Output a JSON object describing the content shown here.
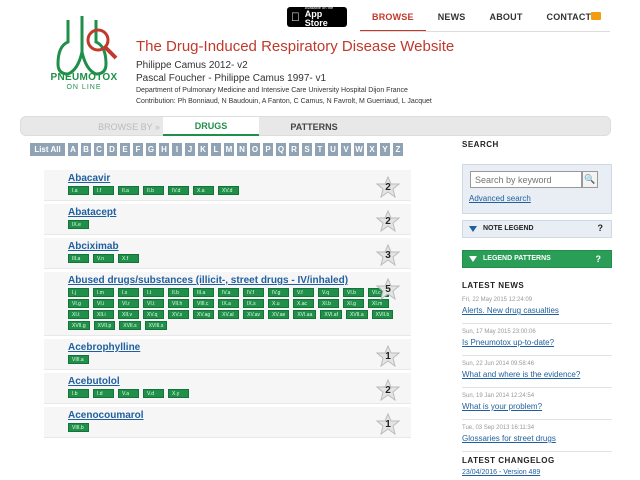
{
  "app_store": {
    "small": "Available on the",
    "big": "App Store"
  },
  "nav": [
    "BROWSE",
    "NEWS",
    "ABOUT",
    "CONTACT"
  ],
  "logo": {
    "word": "PNEUMOTOX",
    "sub": "ON LINE"
  },
  "header": {
    "title": "The Drug-Induced Respiratory Disease Website",
    "line1": "Philippe Camus 2012- v2",
    "line2": "Pascal Foucher - Philippe Camus 1997- v1",
    "line3": "Department of Pulmonary Medicine and Intensive Care University Hospital Dijon France",
    "line4": "Contribution: Ph Bonniaud, N Baudouin, A Fanton, C Camus, N Favrolt, M Guerriaud, L Jacquet"
  },
  "tabs": {
    "browse_by": "BROWSE BY »",
    "drugs": "DRUGS",
    "patterns": "PATTERNS"
  },
  "alphabet": {
    "all": "List All",
    "letters": [
      "A",
      "B",
      "C",
      "D",
      "E",
      "F",
      "G",
      "H",
      "I",
      "J",
      "K",
      "L",
      "M",
      "N",
      "O",
      "P",
      "Q",
      "R",
      "S",
      "T",
      "U",
      "V",
      "W",
      "X",
      "Y",
      "Z"
    ]
  },
  "drugs": [
    {
      "name": "Abacavir",
      "count": "2",
      "codes": [
        "I.a",
        "I.f",
        "II.a",
        "II.b",
        "IV.d",
        "X.a",
        "XV.d"
      ]
    },
    {
      "name": "Abatacept",
      "count": "2",
      "codes": [
        "IX.e"
      ]
    },
    {
      "name": "Abciximab",
      "count": "3",
      "codes": [
        "III.a",
        "V.n",
        "X.f"
      ]
    },
    {
      "name": "Abused drugs/substances (illicit-, street drugs - IV/inhaled)",
      "count": "5",
      "codes": [
        "I.j",
        "I.m",
        "I.s",
        "I.t",
        "II.b",
        "III.a",
        "IV.a",
        "IV.f",
        "IV.g",
        "V.f",
        "V.q",
        "VI.b",
        "VI.c",
        "VI.g",
        "VI.i",
        "VI.r",
        "VI.t",
        "VII.h",
        "VIII.c",
        "IX.a",
        "IX.s",
        "X.u",
        "X.ac",
        "XI.b",
        "XI.g",
        "XI.m",
        "XI.t",
        "XII.i",
        "XII.v",
        "XV.q",
        "XV.s",
        "XV.ag",
        "XV.al",
        "XV.av",
        "XV.ae",
        "XVI.aa",
        "XVI.af",
        "XVII.a",
        "XVII.b",
        "XVII.g",
        "XVII.p",
        "XVII.s",
        "XVIII.s"
      ]
    },
    {
      "name": "Acebrophylline",
      "count": "1",
      "codes": [
        "VIII.a"
      ]
    },
    {
      "name": "Acebutolol",
      "count": "2",
      "codes": [
        "I.b",
        "I.d",
        "V.a",
        "V.d",
        "X.y"
      ]
    },
    {
      "name": "Acenocoumarol",
      "count": "1",
      "codes": [
        "VIII.b"
      ]
    }
  ],
  "sidebar": {
    "search_head": "SEARCH",
    "search_placeholder": "Search by keyword",
    "advanced": "Advanced search",
    "note_legend": "NOTE LEGEND",
    "legend_patterns": "LEGEND PATTERNS",
    "q": "?",
    "latest_news_head": "LATEST NEWS",
    "news": [
      {
        "date": "Fri, 22 May 2015 12:24:09",
        "title": "Alerts. New drug casualties"
      },
      {
        "date": "Sun, 17 May 2015 23:00:06",
        "title": "Is Pneumotox up-to-date?"
      },
      {
        "date": "Sun, 22 Jun 2014 09:58:46",
        "title": "What and where is the evidence?"
      },
      {
        "date": "Sun, 19 Jan 2014 12:24:54",
        "title": "What is your problem?"
      },
      {
        "date": "Tue, 03 Sep 2013 16:11:34",
        "title": "Glossaries for street drugs"
      }
    ],
    "changelog_head": "LATEST CHANGELOG",
    "changelog_item": "23/04/2016 - Version 489"
  },
  "colors": {
    "accent_red": "#c0392b",
    "green": "#1f8f4a",
    "link": "#1f5f9f"
  }
}
